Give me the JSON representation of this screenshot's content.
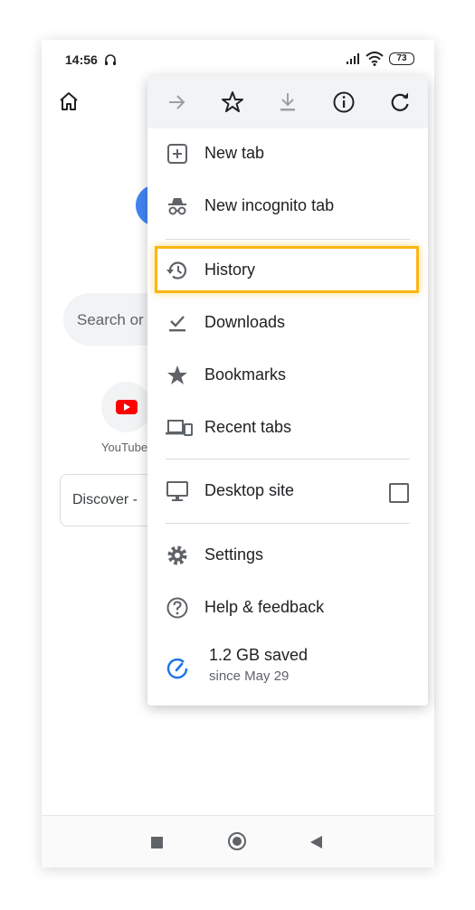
{
  "status_bar": {
    "time": "14:56",
    "battery": "73"
  },
  "background": {
    "search_placeholder": "Search or",
    "shortcuts": [
      {
        "label": "YouTube"
      }
    ],
    "discover_label": "Discover -"
  },
  "menu": {
    "toolbar": [
      "forward-icon",
      "star-icon",
      "download-icon",
      "info-icon",
      "refresh-icon"
    ],
    "items": [
      {
        "label": "New tab",
        "icon": "new-tab-icon"
      },
      {
        "label": "New incognito tab",
        "icon": "incognito-icon"
      },
      {
        "label": "History",
        "icon": "history-icon",
        "highlighted": true
      },
      {
        "label": "Downloads",
        "icon": "downloads-icon"
      },
      {
        "label": "Bookmarks",
        "icon": "star-filled-icon"
      },
      {
        "label": "Recent tabs",
        "icon": "devices-icon"
      },
      {
        "label": "Desktop site",
        "icon": "monitor-icon",
        "checkbox": false
      },
      {
        "label": "Settings",
        "icon": "gear-icon"
      },
      {
        "label": "Help & feedback",
        "icon": "help-icon"
      }
    ],
    "data_saver": {
      "title": "1.2 GB saved",
      "subtitle": "since May 29"
    }
  },
  "colors": {
    "highlight": "#fbb614",
    "icon": "#5f6368",
    "accent": "#1a73e8"
  }
}
